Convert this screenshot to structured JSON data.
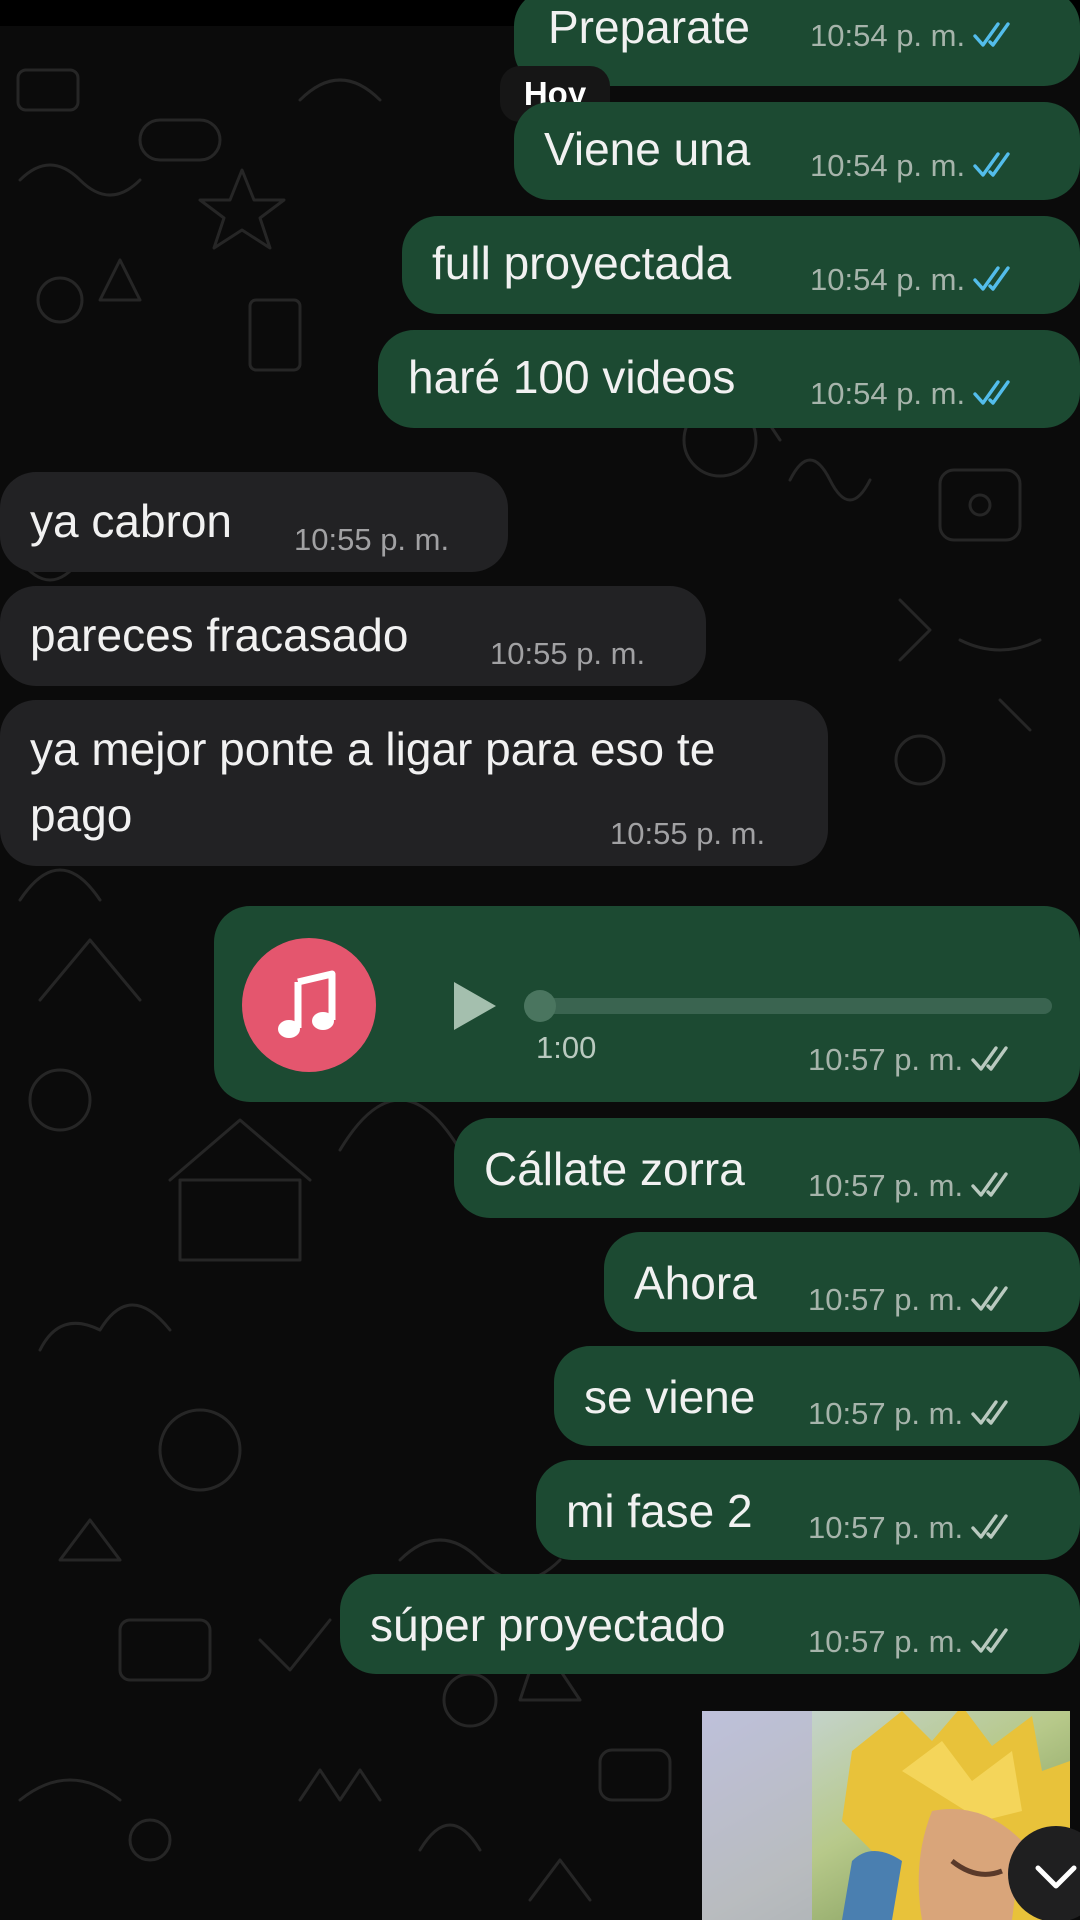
{
  "day_separator": "Hoy",
  "messages": [
    {
      "text": "Preparate",
      "time": "10:54 p. m."
    },
    {
      "text": "Viene una",
      "time": "10:54 p. m."
    },
    {
      "text": "full proyectada",
      "time": "10:54 p. m."
    },
    {
      "text": "haré 100 videos",
      "time": "10:54 p. m."
    },
    {
      "text": "ya cabron",
      "time": "10:55 p. m."
    },
    {
      "text": "pareces fracasado",
      "time": "10:55 p. m."
    },
    {
      "text_line1": "ya mejor ponte a ligar para eso te",
      "text_line2": "pago",
      "time": "10:55 p. m."
    },
    {
      "duration": "1:00",
      "time": "10:57 p. m.",
      "progress": 0
    },
    {
      "text": "Cállate zorra",
      "time": "10:57 p. m."
    },
    {
      "text": "Ahora",
      "time": "10:57 p. m."
    },
    {
      "text": "se viene",
      "time": "10:57 p. m."
    },
    {
      "text": "mi fase 2",
      "time": "10:57 p. m."
    },
    {
      "text": "súper proyectado",
      "time": "10:57 p. m."
    }
  ],
  "colors": {
    "outgoing_bubble": "#1c4a32",
    "incoming_bubble": "#222224",
    "read_ticks": "#53bdeb",
    "delivered_ticks": "#a6b4ab",
    "audio_icon_bg": "#e4566e"
  },
  "icons": {
    "audio_file": "music-note-icon",
    "play": "play-icon",
    "scroll_down": "chevron-down-icon",
    "read_status": "double-check-icon"
  }
}
